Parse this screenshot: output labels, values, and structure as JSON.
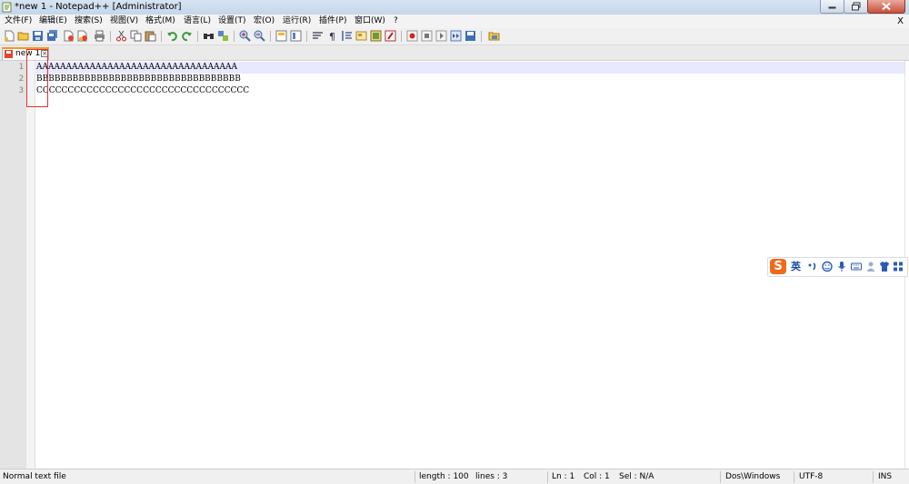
{
  "window": {
    "title": "*new 1 - Notepad++ [Administrator]"
  },
  "menu": {
    "items": [
      "文件(F)",
      "编辑(E)",
      "搜索(S)",
      "视图(V)",
      "格式(M)",
      "语言(L)",
      "设置(T)",
      "宏(O)",
      "运行(R)",
      "插件(P)",
      "窗口(W)",
      "?"
    ],
    "close_doc": "X"
  },
  "toolbar": {
    "icons": [
      "new-file-icon",
      "open-file-icon",
      "save-icon",
      "save-all-icon",
      "close-icon",
      "close-all-icon",
      "print-icon",
      "cut-icon",
      "copy-icon",
      "paste-icon",
      "undo-icon",
      "redo-icon",
      "find-icon",
      "replace-icon",
      "zoom-in-icon",
      "zoom-out-icon",
      "sync-v-icon",
      "sync-h-icon",
      "word-wrap-icon",
      "show-all-chars-icon",
      "indent-guide-icon",
      "user-lang-icon",
      "doc-map-icon",
      "function-list-icon",
      "record-macro-icon",
      "stop-macro-icon",
      "play-macro-icon",
      "run-macro-multiple-icon",
      "save-macro-icon",
      "folder-workspace-icon"
    ]
  },
  "tab": {
    "label": "new 1"
  },
  "editor": {
    "lines": [
      {
        "number": "1",
        "text": "AAAAAAAAAAAAAAAAAAAAAAAAAAAAAAAAAA"
      },
      {
        "number": "2",
        "text": "BBBBBBBBBBBBBBBBBBBBBBBBBBBBBBBBBB"
      },
      {
        "number": "3",
        "text": "CCCCCCCCCCCCCCCCCCCCCCCCCCCCCCCCCC"
      }
    ],
    "current_line_color": "#e8e8ff"
  },
  "ime": {
    "logo": "S",
    "lang": "英",
    "icons": [
      "punctuation-icon",
      "emoji-icon",
      "microphone-icon",
      "keyboard-icon",
      "user-icon",
      "skin-icon",
      "grid-menu-icon"
    ],
    "accent": "#f06a1c"
  },
  "status": {
    "file_type": "Normal text file",
    "length": "length : 100",
    "lines": "lines : 3",
    "ln": "Ln : 1",
    "col": "Col : 1",
    "sel": "Sel : N/A",
    "eol": "Dos\\Windows",
    "encoding": "UTF-8",
    "mode": "INS"
  },
  "colors": {
    "annotation_box": "#e23232",
    "tab_accent": "#f39a23"
  }
}
